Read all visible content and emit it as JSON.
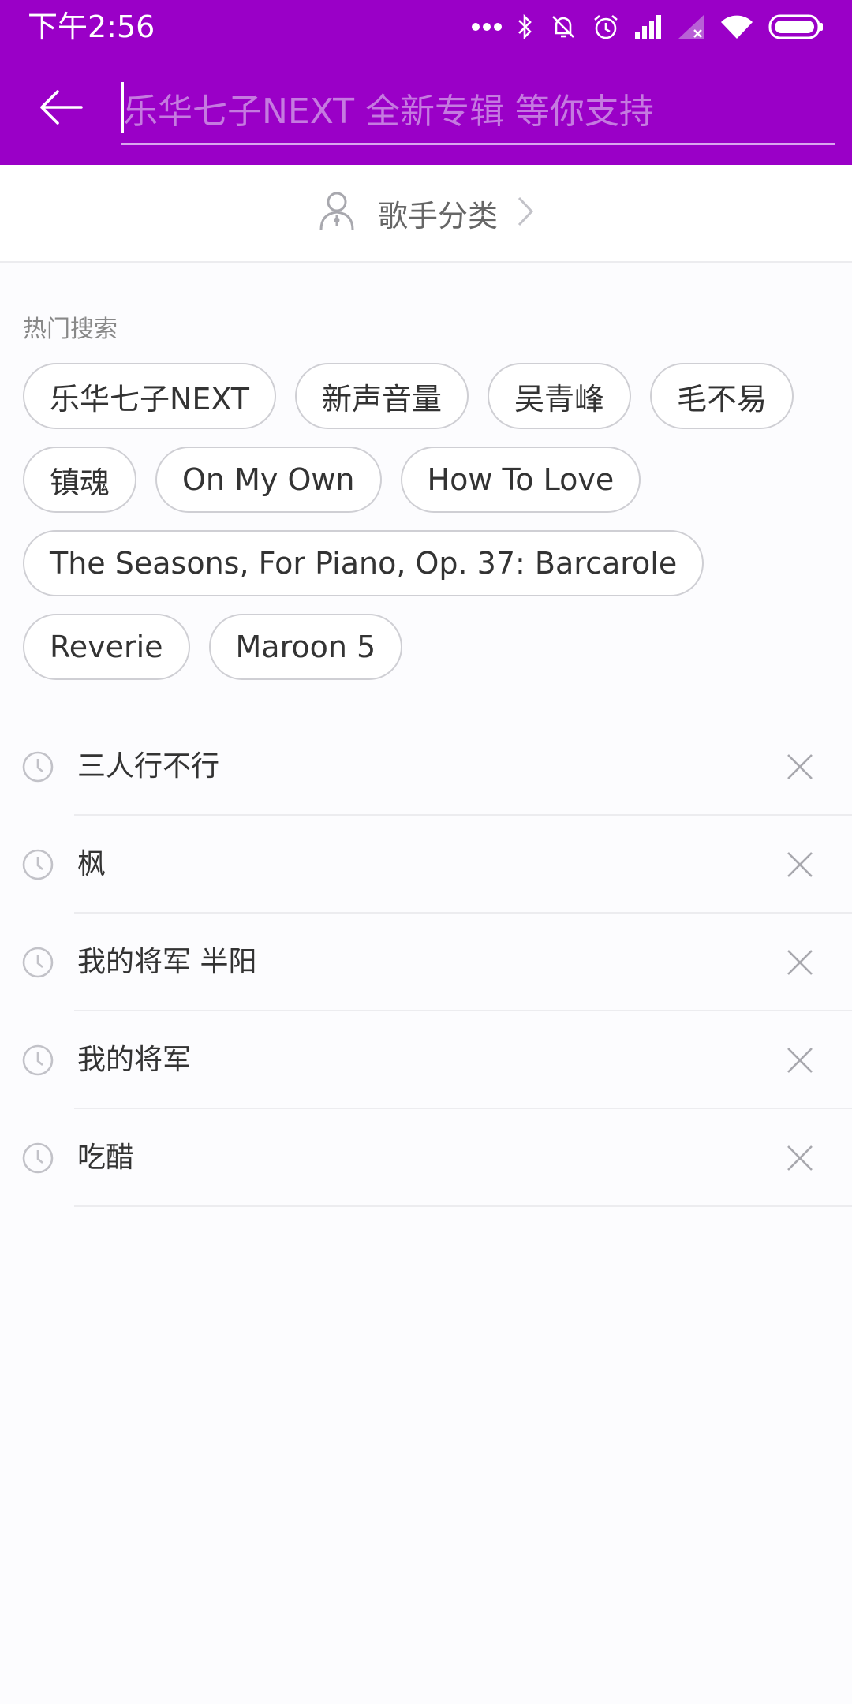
{
  "status_bar": {
    "time": "下午2:56",
    "icons": [
      "more-dots-icon",
      "bluetooth-icon",
      "notifications-off-icon",
      "alarm-icon",
      "signal-icon",
      "signal-none-icon",
      "wifi-icon",
      "battery-icon"
    ]
  },
  "header": {
    "back_icon": "arrow-left-icon",
    "search_placeholder": "乐华七子NEXT 全新专辑 等你支持",
    "background_color": "#9a00c7"
  },
  "singer_category": {
    "icon": "person-icon",
    "label": "歌手分类",
    "chevron": "chevron-right-icon"
  },
  "hot_search": {
    "title": "热门搜索",
    "tags": [
      "乐华七子NEXT",
      "新声音量",
      "吴青峰",
      "毛不易",
      "镇魂",
      "On My Own",
      "How To Love",
      "The Seasons, For Piano, Op. 37: Barcarole",
      "Reverie",
      "Maroon 5"
    ]
  },
  "history": {
    "icon": "clock-icon",
    "delete_icon": "close-icon",
    "items": [
      "三人行不行",
      "枫",
      "我的将军 半阳",
      "我的将军",
      "吃醋"
    ]
  }
}
